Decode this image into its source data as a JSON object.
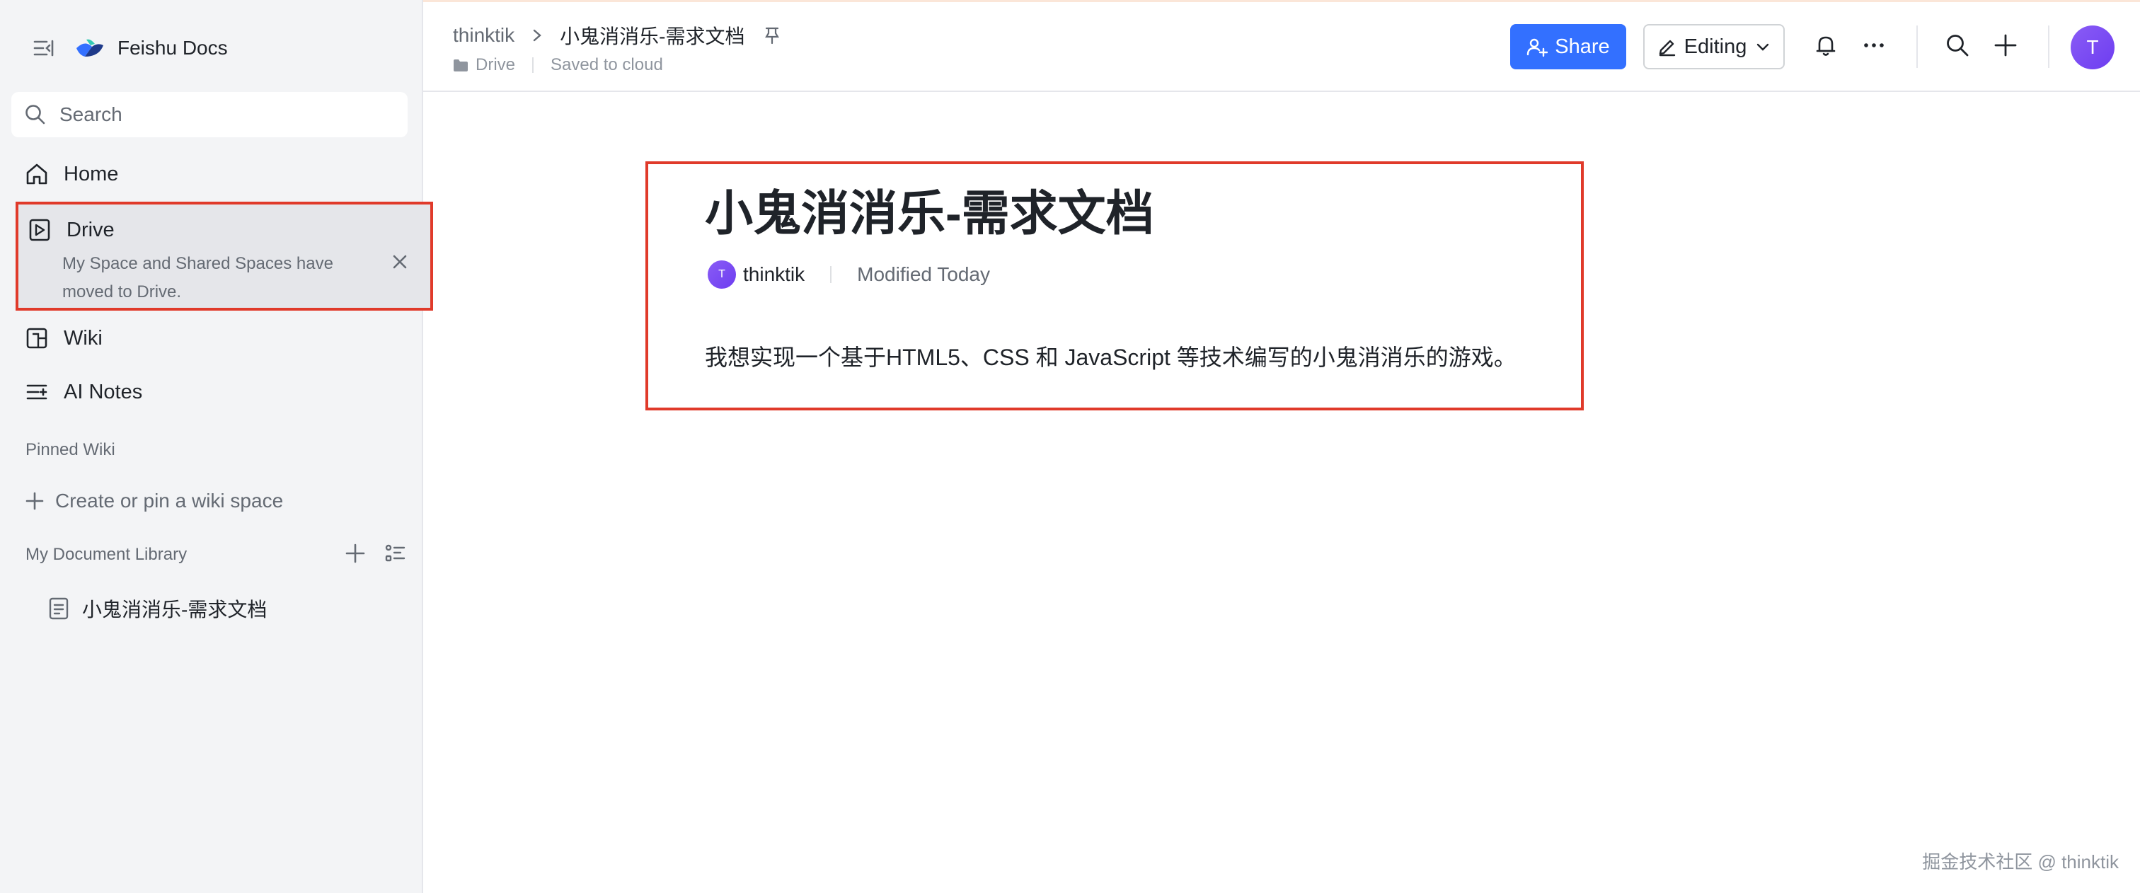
{
  "app": {
    "name": "Feishu Docs"
  },
  "sidebar": {
    "search_placeholder": "Search",
    "home_label": "Home",
    "drive": {
      "label": "Drive",
      "message": "My Space and Shared Spaces have moved to Drive."
    },
    "wiki_label": "Wiki",
    "ai_notes_label": "AI Notes",
    "pinned_wiki_label": "Pinned Wiki",
    "create_wiki_label": "Create or pin a wiki space",
    "doc_library_label": "My Document Library",
    "documents": [
      {
        "title": "小鬼消消乐-需求文档"
      }
    ]
  },
  "header": {
    "breadcrumb_root": "thinktik",
    "breadcrumb_current": "小鬼消消乐-需求文档",
    "location": "Drive",
    "save_status": "Saved to cloud",
    "share_label": "Share",
    "mode_label": "Editing",
    "avatar_initial": "T"
  },
  "document": {
    "title": "小鬼消消乐-需求文档",
    "author": "thinktik",
    "author_initial": "T",
    "modified": "Modified Today",
    "body": "我想实现一个基于HTML5、CSS 和 JavaScript 等技术编写的小鬼消消乐的游戏。"
  },
  "watermark": "掘金技术社区 @ thinktik",
  "colors": {
    "accent": "#3370ff",
    "highlight_border": "#e03a2a",
    "avatar": "#7b4cf3",
    "sidebar_bg": "#f3f4f6"
  }
}
